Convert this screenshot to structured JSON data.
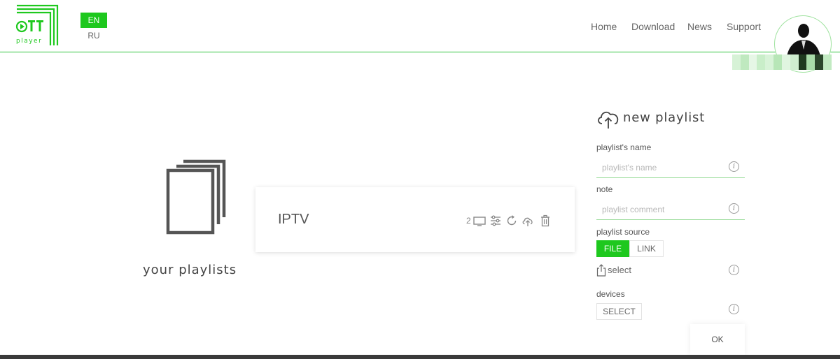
{
  "header": {
    "logo_text": "OTT",
    "logo_subtext": "player",
    "lang_active": "EN",
    "lang_other": "RU",
    "nav": [
      "Home",
      "Download",
      "News",
      "Support"
    ]
  },
  "left": {
    "caption": "your playlists"
  },
  "playlist": {
    "name": "IPTV",
    "device_count": "2"
  },
  "form": {
    "title": "new playlist",
    "name_label": "playlist's name",
    "name_placeholder": "playlist's name",
    "note_label": "note",
    "note_placeholder": "playlist comment",
    "source_label": "playlist source",
    "source_file": "FILE",
    "source_link": "LINK",
    "select_label": "select",
    "devices_label": "devices",
    "devices_button": "SELECT",
    "ok_button": "OK"
  },
  "colors": {
    "accent": "#1ec81e",
    "header_line": "#2ec43b"
  }
}
